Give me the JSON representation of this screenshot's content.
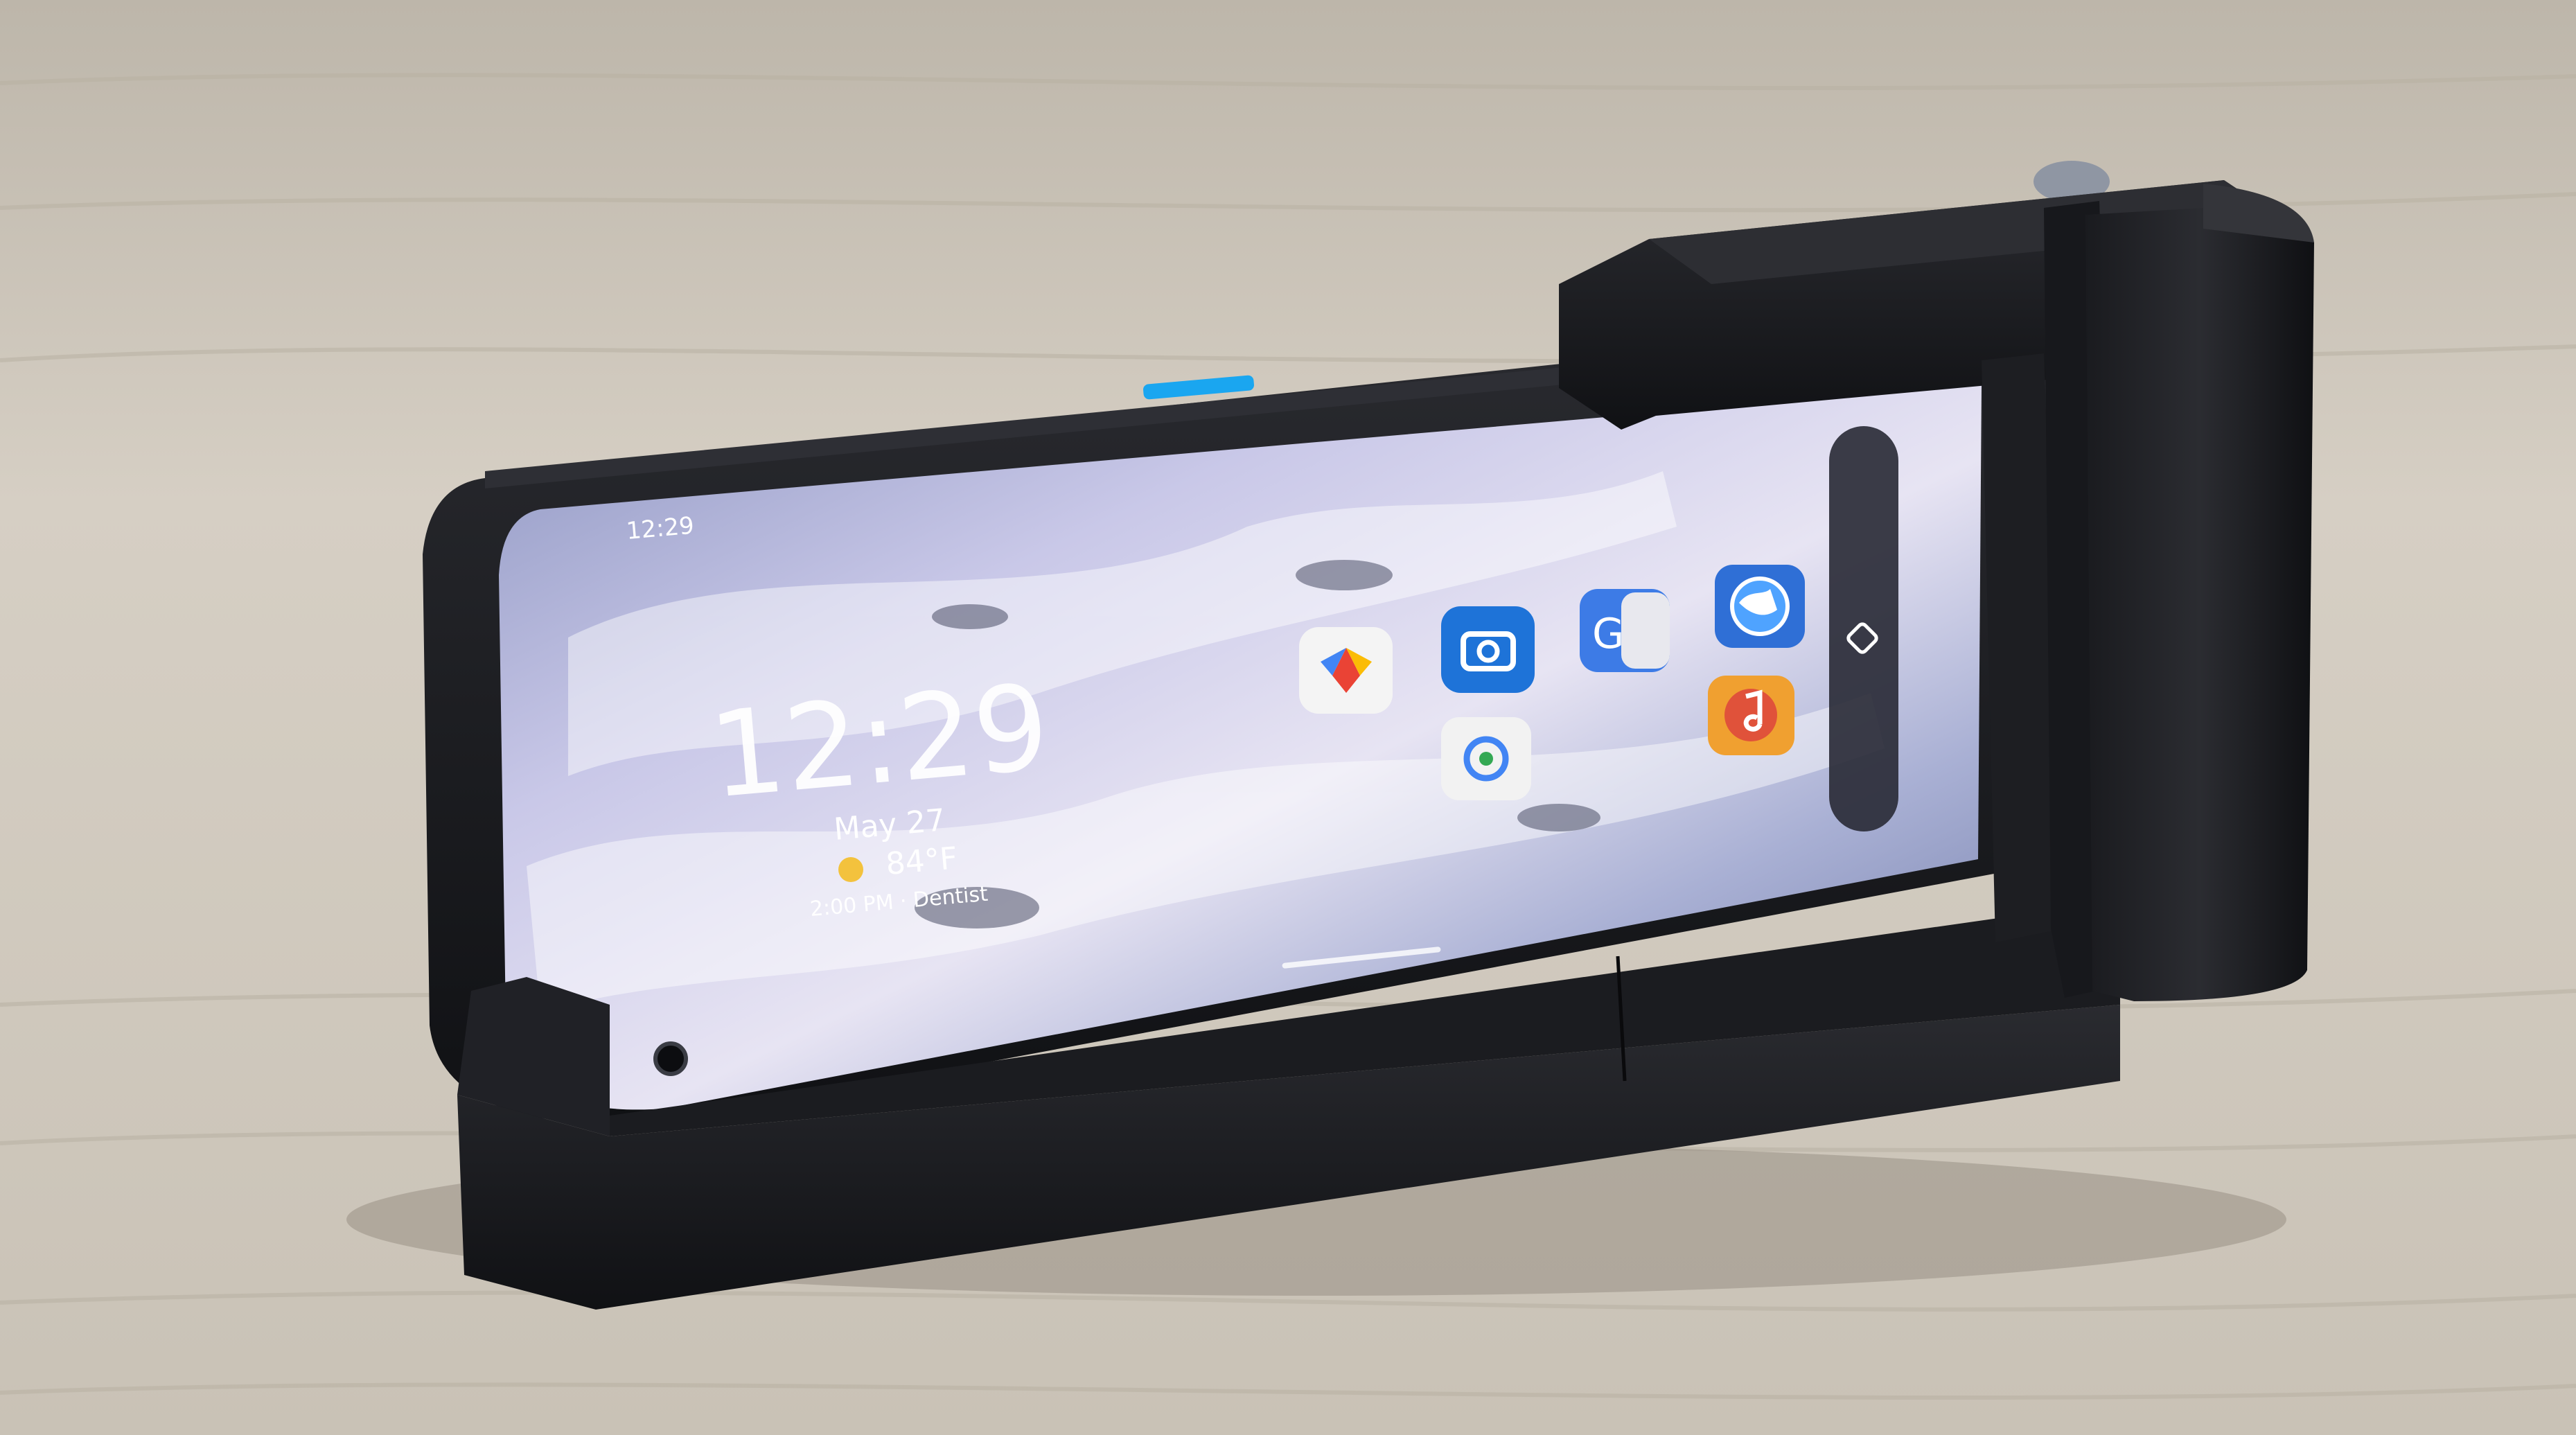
{
  "status_bar": {
    "time": "12:29"
  },
  "lock_screen": {
    "clock": "12:29",
    "date": "May 27",
    "weather": "84°F",
    "event": "2:00 PM · Dentist"
  },
  "apps": [
    {
      "name": "Photos",
      "icon": "pinwheel-icon",
      "color": "#f4f4f4"
    },
    {
      "name": "Camera",
      "icon": "camera-icon",
      "color": "#1e73d8"
    },
    {
      "name": "Translate",
      "icon": "translate-icon",
      "color": "#3d7be6"
    },
    {
      "name": "Browser",
      "icon": "globe-icon",
      "color": "#2f6fd6"
    },
    {
      "name": "Lens",
      "icon": "lens-icon",
      "color": "#f2f2f2"
    },
    {
      "name": "Music",
      "icon": "music-note-icon",
      "color": "#f0a030"
    }
  ],
  "colors": {
    "dock_black": "#15161a",
    "phone_frame": "#1c1d22",
    "accent_button": "#1aa6f0",
    "wood": "#d2cbc0"
  }
}
